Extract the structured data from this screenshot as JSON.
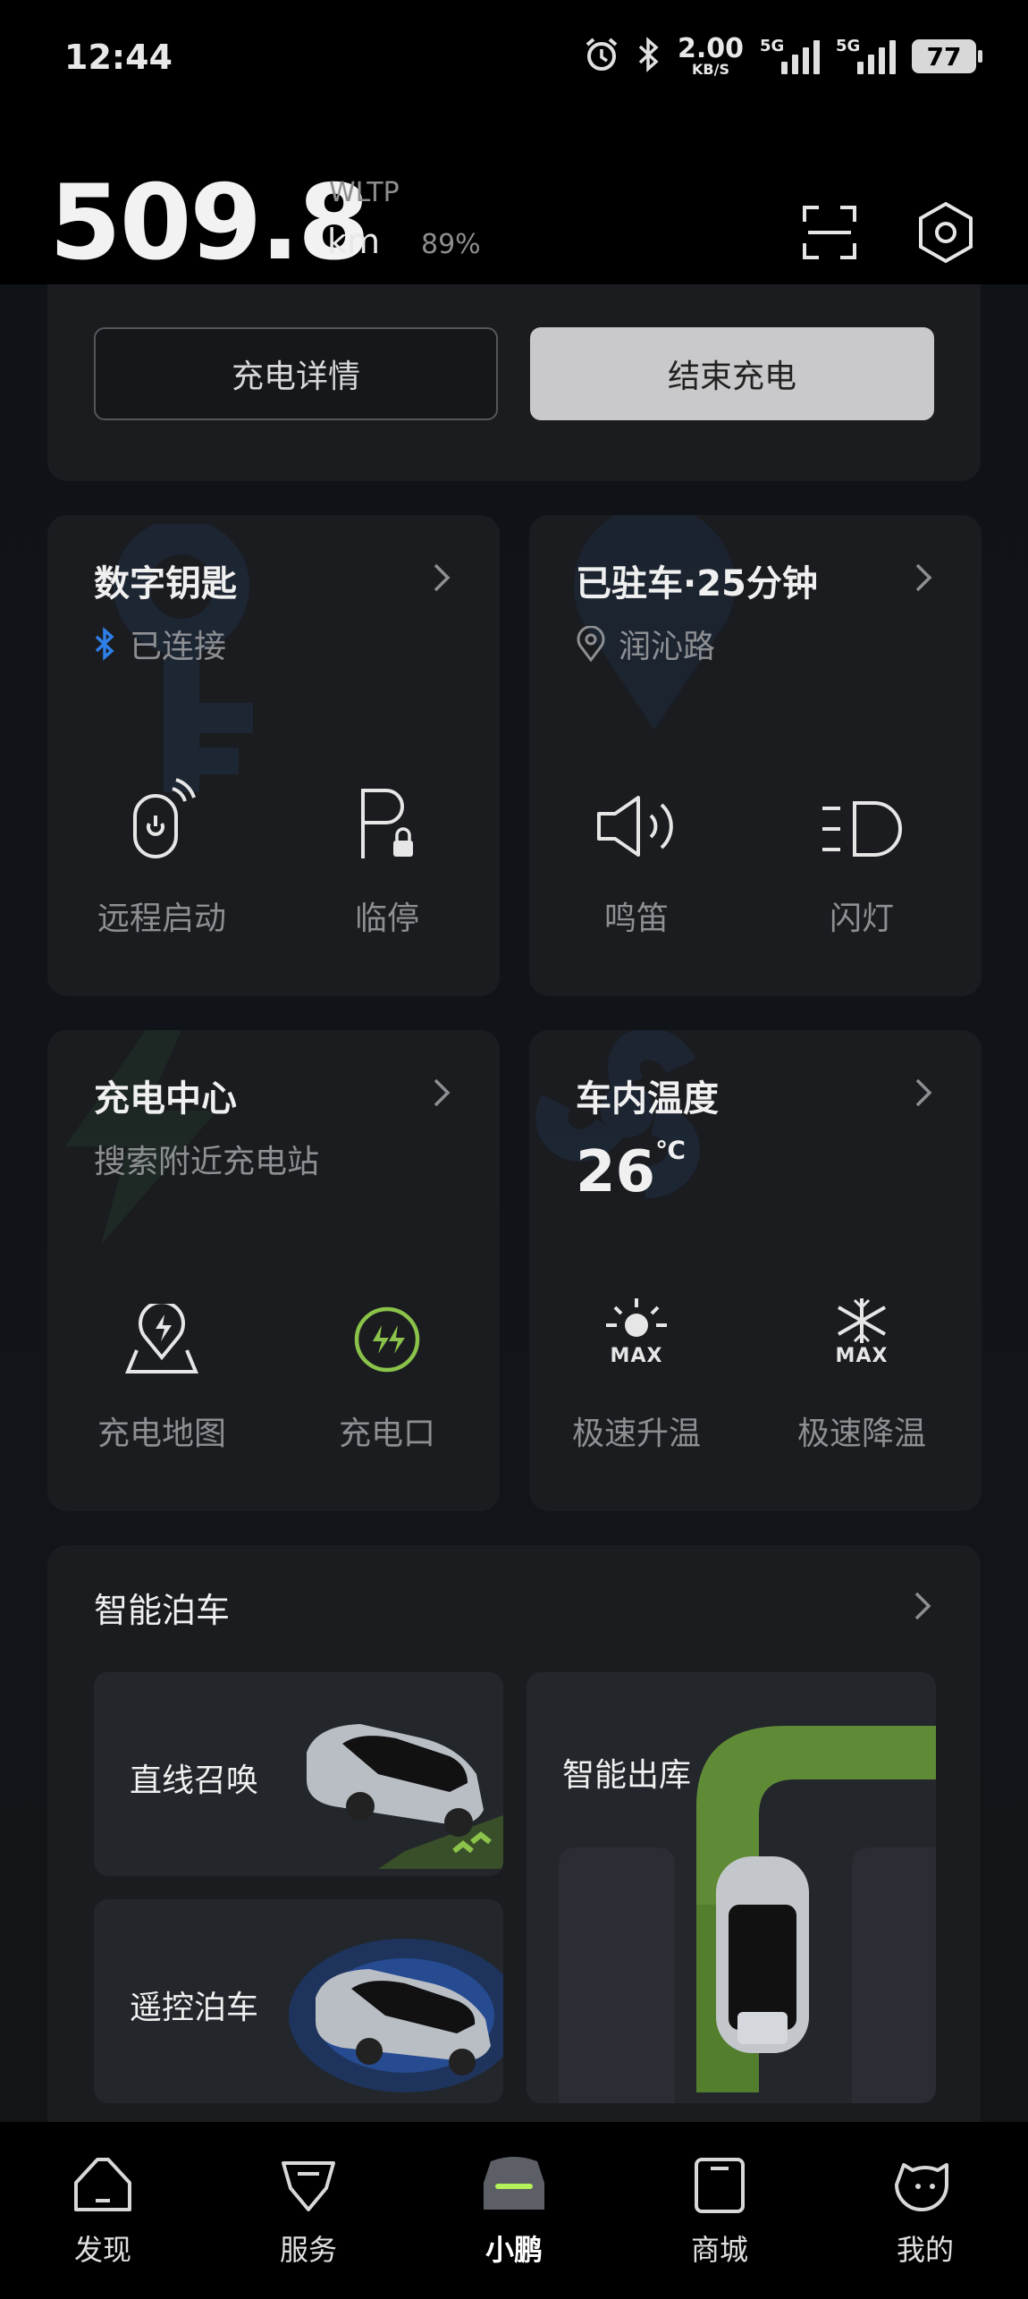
{
  "status_bar": {
    "time": "12:44",
    "net_speed_value": "2.00",
    "net_speed_unit": "KB/S",
    "signal_1_label": "5G",
    "signal_2_label": "5G",
    "battery": "77",
    "icons": [
      "alarm-icon",
      "bluetooth-icon",
      "signal-icon",
      "battery-icon"
    ]
  },
  "header": {
    "range_value": "509.8",
    "range_standard": "WLTP",
    "range_unit": "km",
    "battery_percent": "89%",
    "icons": [
      "scan-icon",
      "settings-icon"
    ]
  },
  "charging_card": {
    "detail_button": "充电详情",
    "stop_button": "结束充电"
  },
  "digital_key_card": {
    "title": "数字钥匙",
    "status": "已连接",
    "actions": [
      {
        "label": "远程启动",
        "icon": "remote-start-icon"
      },
      {
        "label": "临停",
        "icon": "temp-parking-icon"
      }
    ]
  },
  "parking_card": {
    "title": "已驻车·25分钟",
    "location": "润沁路",
    "actions": [
      {
        "label": "鸣笛",
        "icon": "horn-icon"
      },
      {
        "label": "闪灯",
        "icon": "flash-lights-icon"
      }
    ]
  },
  "charging_center_card": {
    "title": "充电中心",
    "subtitle": "搜索附近充电站",
    "actions": [
      {
        "label": "充电地图",
        "icon": "charging-map-icon"
      },
      {
        "label": "充电口",
        "icon": "charging-port-icon"
      }
    ]
  },
  "cabin_temp_card": {
    "title": "车内温度",
    "temperature": "26",
    "unit": "℃",
    "actions": [
      {
        "label": "极速升温",
        "icon": "max-heat-icon",
        "badge": "MAX"
      },
      {
        "label": "极速降温",
        "icon": "max-cool-icon",
        "badge": "MAX"
      }
    ]
  },
  "smart_parking_card": {
    "title": "智能泊车",
    "tiles": [
      {
        "label": "直线召唤"
      },
      {
        "label": "遥控泊车"
      },
      {
        "label": "智能出库"
      }
    ]
  },
  "bottom_nav": {
    "items": [
      {
        "label": "发现",
        "icon": "discover-icon"
      },
      {
        "label": "服务",
        "icon": "service-icon"
      },
      {
        "label": "小鹏",
        "icon": "car-icon",
        "active": true
      },
      {
        "label": "商城",
        "icon": "shop-icon"
      },
      {
        "label": "我的",
        "icon": "profile-icon"
      }
    ]
  },
  "colors": {
    "background": "#000000",
    "card": "#1a1c20",
    "accent_green": "#8bc34a",
    "bluetooth_blue": "#2f7fe8"
  }
}
